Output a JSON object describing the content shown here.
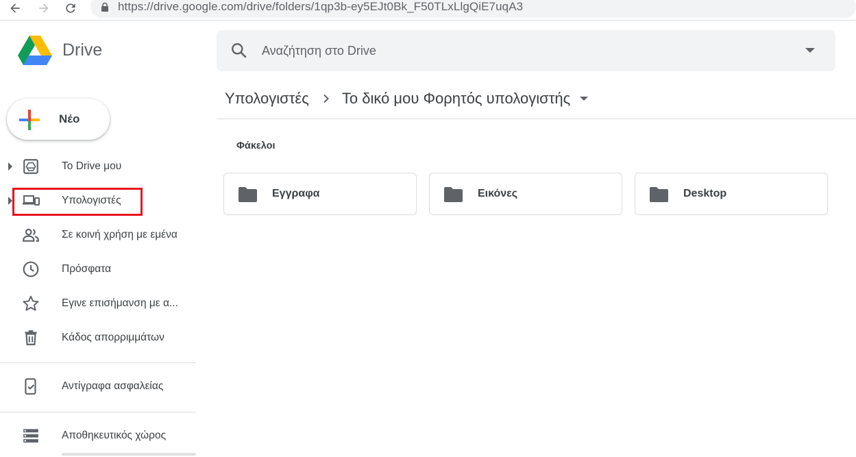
{
  "browser": {
    "url": "https://drive.google.com/drive/folders/1qp3b-ey5EJt0Bk_F50TLxLlgQiE7uqA3"
  },
  "app": {
    "name": "Drive"
  },
  "sidebar": {
    "new_label": "Νέο",
    "items": [
      {
        "label": "Το Drive μου",
        "icon": "my-drive-icon"
      },
      {
        "label": "Υπολογιστές",
        "icon": "computers-icon"
      },
      {
        "label": "Σε κοινή χρήση με εμένα",
        "icon": "shared-icon"
      },
      {
        "label": "Πρόσφατα",
        "icon": "clock-icon"
      },
      {
        "label": "Εγινε επισήμανση με α...",
        "icon": "star-icon"
      },
      {
        "label": "Κάδος απορριμμάτων",
        "icon": "trash-icon"
      },
      {
        "label": "Αντίγραφα ασφαλείας",
        "icon": "backup-icon"
      },
      {
        "label": "Αποθηκευτικός χώρος",
        "icon": "storage-icon"
      }
    ]
  },
  "search": {
    "placeholder": "Αναζήτηση στο Drive"
  },
  "breadcrumb": {
    "parent": "Υπολογιστές",
    "current": "Το δικό μου Φορητός υπολογιστής"
  },
  "main": {
    "section_label": "Φάκελοι",
    "folders": [
      {
        "name": "Εγγραφα"
      },
      {
        "name": "Εικόνες"
      },
      {
        "name": "Desktop"
      }
    ]
  },
  "colors": {
    "highlight": "#e8141c",
    "search_bg": "#f1f3f4",
    "icon": "#5f6368"
  }
}
